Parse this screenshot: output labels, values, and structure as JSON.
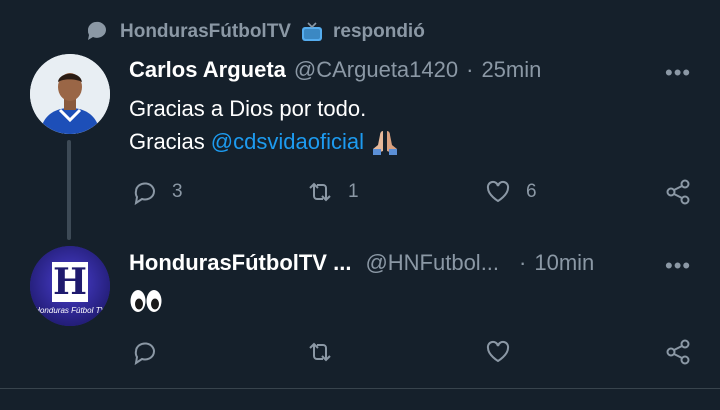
{
  "context": {
    "account": "HondurasFútbolTV",
    "emoji": "tv-emoji",
    "action": "respondió"
  },
  "tweet1": {
    "name": "Carlos Argueta",
    "handle": "@CArgueta1420",
    "sep": "·",
    "time": "25min",
    "line1": "Gracias a Dios por todo.",
    "line2_prefix": "Gracias",
    "mention": "@cdsvidaoficial",
    "emoji": "folded-hands-emoji",
    "replies": "3",
    "retweets": "1",
    "likes": "6"
  },
  "tweet2": {
    "name": "HondurasFútbolTV ...",
    "handle": "@HNFutbol...",
    "sep": "·",
    "time": "10min",
    "emoji": "eyes-emoji",
    "avatar_letter": "H",
    "avatar_caption": "Honduras Fútbol TV"
  },
  "more_label": "•••",
  "colors": {
    "background": "#15202b",
    "muted": "#8b98a5",
    "link": "#1d9bf0",
    "divider": "#38444d"
  }
}
